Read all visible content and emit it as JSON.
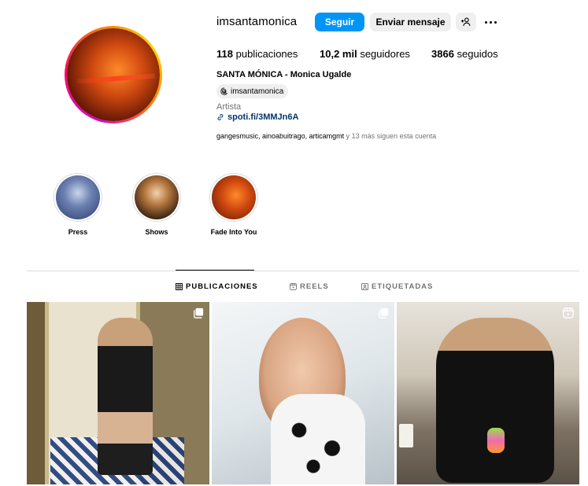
{
  "profile": {
    "username": "imsantamonica",
    "follow_label": "Seguir",
    "message_label": "Enviar mensaje",
    "posts_count": "118",
    "posts_label": "publicaciones",
    "followers_count": "10,2 mil",
    "followers_label": "seguidores",
    "following_count": "3866",
    "following_label": "seguidos",
    "full_name": "SANTA MÓNICA - Monica Ugalde",
    "threads_handle": "imsantamonica",
    "category": "Artista",
    "link": "spoti.fi/3MMJn6A",
    "followed_by_names": "gangesmusic, ainoabuitrago, articamgmt",
    "followed_by_suffix": "y 13 más siguen esta cuenta"
  },
  "highlights": [
    {
      "label": "Press"
    },
    {
      "label": "Shows"
    },
    {
      "label": "Fade Into You"
    }
  ],
  "tabs": [
    {
      "label": "PUBLICACIONES",
      "active": true
    },
    {
      "label": "REELS",
      "active": false
    },
    {
      "label": "ETIQUETADAS",
      "active": false
    }
  ],
  "posts": [
    {
      "type": "carousel",
      "icon": "multiple-photos-icon"
    },
    {
      "type": "carousel",
      "icon": "multiple-photos-icon"
    },
    {
      "type": "reel",
      "icon": "reel-icon"
    }
  ],
  "colors": {
    "follow_button": "#0095f6",
    "secondary_button": "#efefef",
    "link": "#00376b",
    "muted_text": "#737373"
  }
}
